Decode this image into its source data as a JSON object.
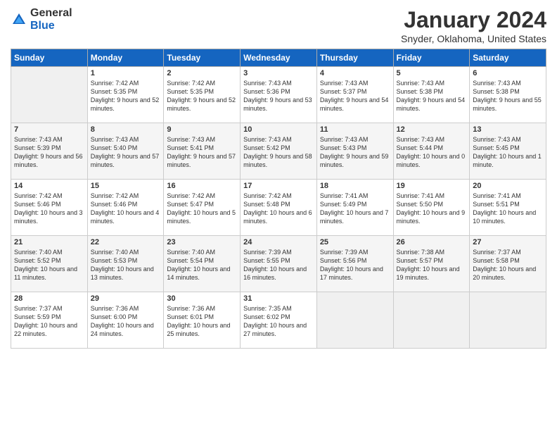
{
  "header": {
    "logo_general": "General",
    "logo_blue": "Blue",
    "month_title": "January 2024",
    "subtitle": "Snyder, Oklahoma, United States"
  },
  "days_of_week": [
    "Sunday",
    "Monday",
    "Tuesday",
    "Wednesday",
    "Thursday",
    "Friday",
    "Saturday"
  ],
  "weeks": [
    [
      {
        "num": "",
        "empty": true
      },
      {
        "num": "1",
        "sunrise": "7:42 AM",
        "sunset": "5:35 PM",
        "daylight": "9 hours and 52 minutes."
      },
      {
        "num": "2",
        "sunrise": "7:42 AM",
        "sunset": "5:35 PM",
        "daylight": "9 hours and 52 minutes."
      },
      {
        "num": "3",
        "sunrise": "7:43 AM",
        "sunset": "5:36 PM",
        "daylight": "9 hours and 53 minutes."
      },
      {
        "num": "4",
        "sunrise": "7:43 AM",
        "sunset": "5:37 PM",
        "daylight": "9 hours and 54 minutes."
      },
      {
        "num": "5",
        "sunrise": "7:43 AM",
        "sunset": "5:38 PM",
        "daylight": "9 hours and 54 minutes."
      },
      {
        "num": "6",
        "sunrise": "7:43 AM",
        "sunset": "5:38 PM",
        "daylight": "9 hours and 55 minutes."
      }
    ],
    [
      {
        "num": "7",
        "sunrise": "7:43 AM",
        "sunset": "5:39 PM",
        "daylight": "9 hours and 56 minutes."
      },
      {
        "num": "8",
        "sunrise": "7:43 AM",
        "sunset": "5:40 PM",
        "daylight": "9 hours and 57 minutes."
      },
      {
        "num": "9",
        "sunrise": "7:43 AM",
        "sunset": "5:41 PM",
        "daylight": "9 hours and 57 minutes."
      },
      {
        "num": "10",
        "sunrise": "7:43 AM",
        "sunset": "5:42 PM",
        "daylight": "9 hours and 58 minutes."
      },
      {
        "num": "11",
        "sunrise": "7:43 AM",
        "sunset": "5:43 PM",
        "daylight": "9 hours and 59 minutes."
      },
      {
        "num": "12",
        "sunrise": "7:43 AM",
        "sunset": "5:44 PM",
        "daylight": "10 hours and 0 minutes."
      },
      {
        "num": "13",
        "sunrise": "7:43 AM",
        "sunset": "5:45 PM",
        "daylight": "10 hours and 1 minute."
      }
    ],
    [
      {
        "num": "14",
        "sunrise": "7:42 AM",
        "sunset": "5:46 PM",
        "daylight": "10 hours and 3 minutes."
      },
      {
        "num": "15",
        "sunrise": "7:42 AM",
        "sunset": "5:46 PM",
        "daylight": "10 hours and 4 minutes."
      },
      {
        "num": "16",
        "sunrise": "7:42 AM",
        "sunset": "5:47 PM",
        "daylight": "10 hours and 5 minutes."
      },
      {
        "num": "17",
        "sunrise": "7:42 AM",
        "sunset": "5:48 PM",
        "daylight": "10 hours and 6 minutes."
      },
      {
        "num": "18",
        "sunrise": "7:41 AM",
        "sunset": "5:49 PM",
        "daylight": "10 hours and 7 minutes."
      },
      {
        "num": "19",
        "sunrise": "7:41 AM",
        "sunset": "5:50 PM",
        "daylight": "10 hours and 9 minutes."
      },
      {
        "num": "20",
        "sunrise": "7:41 AM",
        "sunset": "5:51 PM",
        "daylight": "10 hours and 10 minutes."
      }
    ],
    [
      {
        "num": "21",
        "sunrise": "7:40 AM",
        "sunset": "5:52 PM",
        "daylight": "10 hours and 11 minutes."
      },
      {
        "num": "22",
        "sunrise": "7:40 AM",
        "sunset": "5:53 PM",
        "daylight": "10 hours and 13 minutes."
      },
      {
        "num": "23",
        "sunrise": "7:40 AM",
        "sunset": "5:54 PM",
        "daylight": "10 hours and 14 minutes."
      },
      {
        "num": "24",
        "sunrise": "7:39 AM",
        "sunset": "5:55 PM",
        "daylight": "10 hours and 16 minutes."
      },
      {
        "num": "25",
        "sunrise": "7:39 AM",
        "sunset": "5:56 PM",
        "daylight": "10 hours and 17 minutes."
      },
      {
        "num": "26",
        "sunrise": "7:38 AM",
        "sunset": "5:57 PM",
        "daylight": "10 hours and 19 minutes."
      },
      {
        "num": "27",
        "sunrise": "7:37 AM",
        "sunset": "5:58 PM",
        "daylight": "10 hours and 20 minutes."
      }
    ],
    [
      {
        "num": "28",
        "sunrise": "7:37 AM",
        "sunset": "5:59 PM",
        "daylight": "10 hours and 22 minutes."
      },
      {
        "num": "29",
        "sunrise": "7:36 AM",
        "sunset": "6:00 PM",
        "daylight": "10 hours and 24 minutes."
      },
      {
        "num": "30",
        "sunrise": "7:36 AM",
        "sunset": "6:01 PM",
        "daylight": "10 hours and 25 minutes."
      },
      {
        "num": "31",
        "sunrise": "7:35 AM",
        "sunset": "6:02 PM",
        "daylight": "10 hours and 27 minutes."
      },
      {
        "num": "",
        "empty": true
      },
      {
        "num": "",
        "empty": true
      },
      {
        "num": "",
        "empty": true
      }
    ]
  ]
}
